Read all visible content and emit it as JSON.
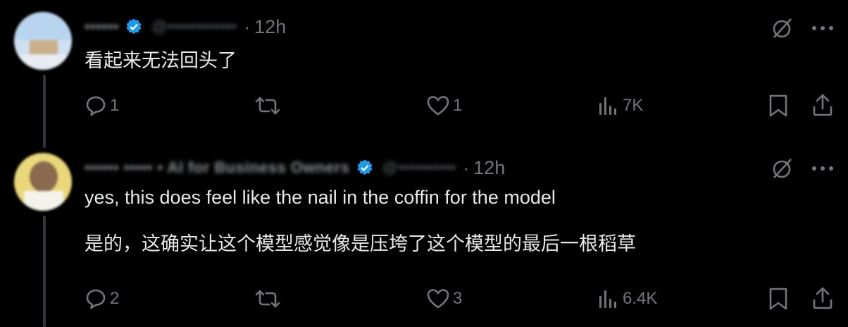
{
  "posts": [
    {
      "display_name": "••••••",
      "handle": "@••••••••••••",
      "time": "12h",
      "lines": [
        "看起来无法回头了"
      ],
      "actions": {
        "replies": "1",
        "reposts": "",
        "likes": "1",
        "views": "7K"
      }
    },
    {
      "display_name": "•••••• ••••• • AI for Business Owners",
      "handle": "@••••••••••",
      "time": "12h",
      "lines": [
        "yes, this does feel like the nail in the coffin for the model",
        "是的，这确实让这个模型感觉像是压垮了这个模型的最后一根稻草"
      ],
      "actions": {
        "replies": "2",
        "reposts": "",
        "likes": "3",
        "views": "6.4K"
      }
    }
  ],
  "icons": {
    "verified_badge": "verified-badge-icon",
    "grok": "grok-icon",
    "more": "more-icon",
    "reply": "reply-icon",
    "repost": "repost-icon",
    "like": "like-icon",
    "views": "views-icon",
    "bookmark": "bookmark-icon",
    "share": "share-icon"
  },
  "colors": {
    "background": "#000000",
    "text": "#e7e9ea",
    "muted": "#71767b",
    "verified": "#1d9bf0",
    "thread_line": "#333639"
  }
}
